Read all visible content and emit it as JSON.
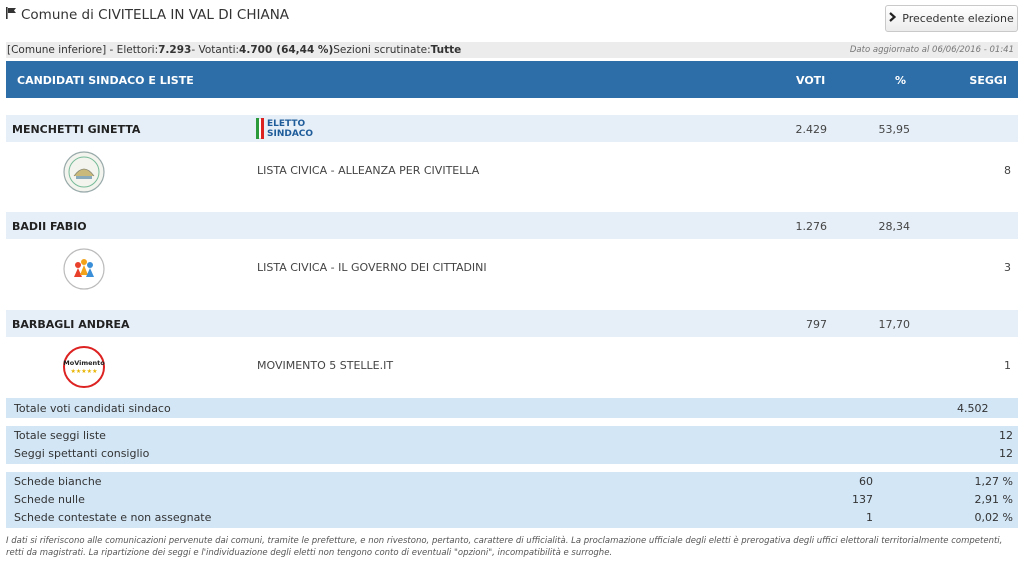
{
  "page": {
    "title": "Comune di CIVITELLA IN VAL DI CHIANA",
    "prev_button": "Precedente elezione"
  },
  "info": {
    "prefix": "[Comune inferiore] - Elettori: ",
    "elettori": "7.293",
    "votanti_label": " - Votanti: ",
    "votanti": "4.700",
    "votanti_pct": "(64,44 %)",
    "sezioni_label": " Sezioni scrutinate: ",
    "sezioni": "Tutte",
    "updated": "Dato aggiornato al 06/06/2016 - 01:41"
  },
  "header": {
    "candidati": "CANDIDATI SINDACO E LISTE",
    "voti": "VOTI",
    "pct": "%",
    "seggi": "SEGGI"
  },
  "eletto_badge": {
    "line1": "ELETTO",
    "line2": "SINDACO"
  },
  "candidates": [
    {
      "name": "MENCHETTI GINETTA",
      "votes": "2.429",
      "pct": "53,95",
      "elected": true,
      "list": {
        "name": "LISTA CIVICA - ALLEANZA PER CIVITELLA",
        "seats": "8",
        "logo": "alleanza-logo"
      }
    },
    {
      "name": "BADII FABIO",
      "votes": "1.276",
      "pct": "28,34",
      "elected": false,
      "list": {
        "name": "LISTA CIVICA - IL GOVERNO DEI CITTADINI",
        "seats": "3",
        "logo": "governo-logo"
      }
    },
    {
      "name": "BARBAGLI ANDREA",
      "votes": "797",
      "pct": "17,70",
      "elected": false,
      "list": {
        "name": "MOVIMENTO 5 STELLE.IT",
        "seats": "1",
        "logo": "m5s-logo",
        "logo_text": "MoVimento"
      }
    }
  ],
  "totals": {
    "voti_candidati_label": "Totale voti candidati sindaco",
    "voti_candidati": "4.502",
    "seggi_liste_label": "Totale seggi liste",
    "seggi_liste": "12",
    "seggi_consiglio_label": "Seggi spettanti consiglio",
    "seggi_consiglio": "12",
    "schede": [
      {
        "label": "Schede bianche",
        "value": "60",
        "pct": "1,27 %"
      },
      {
        "label": "Schede nulle",
        "value": "137",
        "pct": "2,91 %"
      },
      {
        "label": "Schede contestate e non assegnate",
        "value": "1",
        "pct": "0,02 %"
      }
    ]
  },
  "footer": "I dati si riferiscono alle comunicazioni pervenute dai comuni, tramite le prefetture, e non rivestono, pertanto, carattere di ufficialità. La proclamazione ufficiale degli eletti è prerogativa degli uffici elettorali territorialmente competenti, retti da magistrati. La ripartizione dei seggi e l'individuazione degli eletti non tengono conto di eventuali \"opzioni\", incompatibilità e surroghe.",
  "colors": {
    "header": "#2d6ea8",
    "candidate_row": "#e6eff8",
    "totals": "#d2e6f6",
    "eletto": "#1f5c9a"
  }
}
